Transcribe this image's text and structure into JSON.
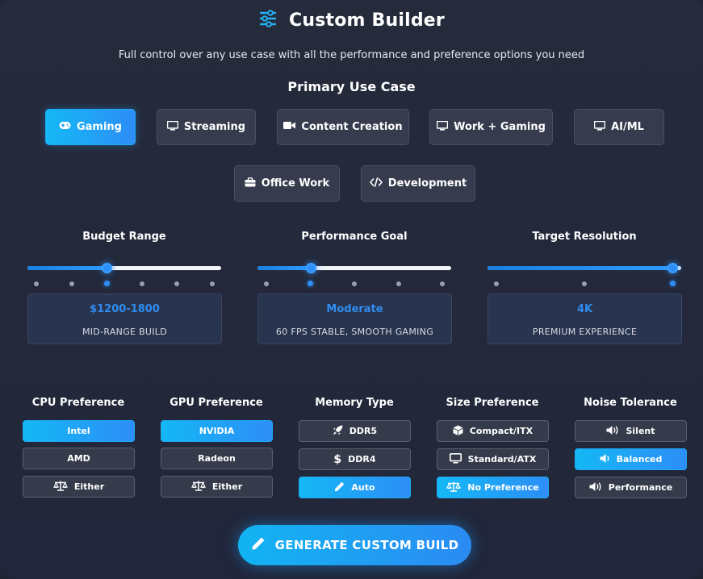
{
  "header": {
    "icon": "sliders-icon",
    "title": "Custom Builder",
    "subtitle": "Full control over any use case with all the performance and preference options you need"
  },
  "use_case": {
    "title": "Primary Use Case",
    "selected": "Gaming",
    "options": [
      {
        "label": "Gaming",
        "icon": "gamepad-icon",
        "active": true
      },
      {
        "label": "Streaming",
        "icon": "monitor-icon",
        "active": false
      },
      {
        "label": "Content Creation",
        "icon": "video-camera-icon",
        "active": false
      },
      {
        "label": "Work + Gaming",
        "icon": "monitor-icon",
        "active": false
      },
      {
        "label": "AI/ML",
        "icon": "monitor-icon",
        "active": false
      },
      {
        "label": "Office Work",
        "icon": "briefcase-icon",
        "active": false
      },
      {
        "label": "Development",
        "icon": "code-icon",
        "active": false
      }
    ]
  },
  "sliders": [
    {
      "label": "Budget Range",
      "steps": 6,
      "selected_index": 2,
      "value": "$1200-1800",
      "caption": "MID-RANGE BUILD"
    },
    {
      "label": "Performance Goal",
      "steps": 5,
      "selected_index": 1,
      "value": "Moderate",
      "caption": "60 FPS STABLE, SMOOTH GAMING"
    },
    {
      "label": "Target Resolution",
      "steps": 3,
      "selected_index": 2,
      "value": "4K",
      "caption": "PREMIUM EXPERIENCE"
    }
  ],
  "preferences": [
    {
      "title": "CPU Preference",
      "options": [
        {
          "label": "Intel",
          "icon": "",
          "active": true
        },
        {
          "label": "AMD",
          "icon": "",
          "active": false
        },
        {
          "label": "Either",
          "icon": "scale-icon",
          "active": false
        }
      ]
    },
    {
      "title": "GPU Preference",
      "options": [
        {
          "label": "NVIDIA",
          "icon": "",
          "active": true
        },
        {
          "label": "Radeon",
          "icon": "",
          "active": false
        },
        {
          "label": "Either",
          "icon": "scale-icon",
          "active": false
        }
      ]
    },
    {
      "title": "Memory Type",
      "options": [
        {
          "label": "DDR5",
          "icon": "rocket-icon",
          "active": false
        },
        {
          "label": "DDR4",
          "icon": "dollar-icon",
          "active": false
        },
        {
          "label": "Auto",
          "icon": "pencil-icon",
          "active": true
        }
      ]
    },
    {
      "title": "Size Preference",
      "options": [
        {
          "label": "Compact/ITX",
          "icon": "cube-icon",
          "active": false
        },
        {
          "label": "Standard/ATX",
          "icon": "monitor-icon",
          "active": false
        },
        {
          "label": "No Preference",
          "icon": "scale-icon",
          "active": true
        }
      ]
    },
    {
      "title": "Noise Tolerance",
      "options": [
        {
          "label": "Silent",
          "icon": "volume-icon",
          "active": false
        },
        {
          "label": "Balanced",
          "icon": "volume-low-icon",
          "active": true
        },
        {
          "label": "Performance",
          "icon": "volume-high-icon",
          "active": false
        }
      ]
    }
  ],
  "generate_button": {
    "label": "GENERATE CUSTOM BUILD",
    "icon": "pencil-icon"
  },
  "colors": {
    "accent": "#2d8ef7",
    "accent_light": "#14b8f5",
    "panel": "#262b3b",
    "button": "#363b4d"
  }
}
